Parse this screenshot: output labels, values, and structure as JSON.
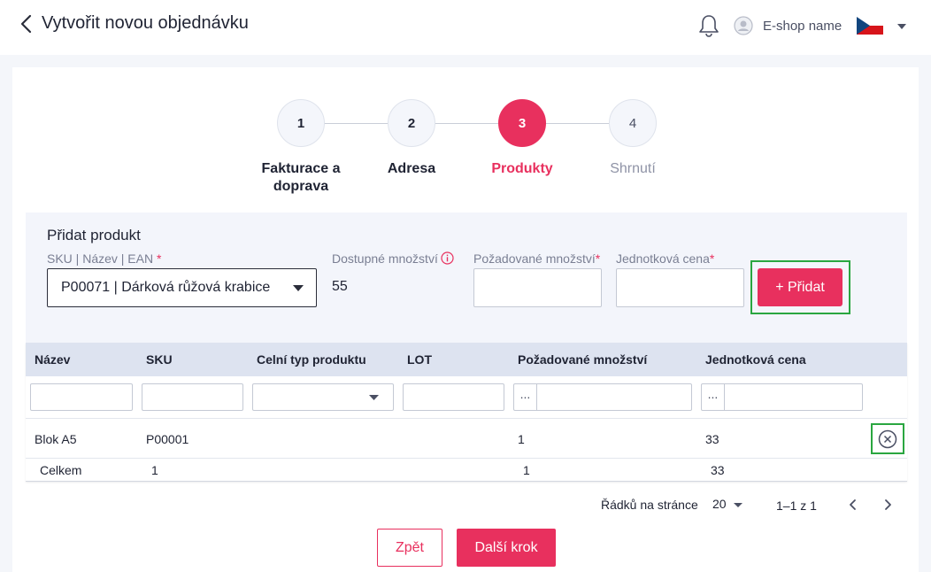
{
  "header": {
    "title": "Vytvořit novou objednávku",
    "shop_name": "E-shop name"
  },
  "steps": [
    {
      "number": "1",
      "label": "Fakturace a doprava",
      "state": "done"
    },
    {
      "number": "2",
      "label": "Adresa",
      "state": "done"
    },
    {
      "number": "3",
      "label": "Produkty",
      "state": "active"
    },
    {
      "number": "4",
      "label": "Shrnutí",
      "state": "future"
    }
  ],
  "add_product": {
    "title": "Přidat produkt",
    "sku_label": "SKU | Název | EAN",
    "sku_value": "P00071 | Dárková růžová krabice",
    "available_label": "Dostupné množství",
    "available_value": "55",
    "requested_label": "Požadované množství",
    "requested_value": "",
    "unit_price_label": "Jednotková cena",
    "unit_price_value": "",
    "required_mark": "*",
    "add_button": "+ Přidat"
  },
  "table": {
    "columns": [
      "Název",
      "SKU",
      "Celní typ produktu",
      "LOT",
      "Požadované množství",
      "Jednotková cena"
    ],
    "range_prefix": "...",
    "rows": [
      {
        "name": "Blok A5",
        "sku": "P00001",
        "customs_type": "",
        "lot": "",
        "quantity": "1",
        "unit_price": "33"
      }
    ],
    "total": {
      "label": "Celkem",
      "sku": "1",
      "quantity": "1",
      "unit_price": "33"
    }
  },
  "pagination": {
    "rows_per_page_label": "Řádků na stránce",
    "rows_per_page": "20",
    "range": "1–1 z 1"
  },
  "footer": {
    "back_button": "Zpět",
    "next_button": "Další krok"
  },
  "colors": {
    "accent": "#e8305e",
    "highlight": "#2aa640",
    "table_header": "#dde3f0",
    "panel_bg": "#f3f5fb"
  }
}
